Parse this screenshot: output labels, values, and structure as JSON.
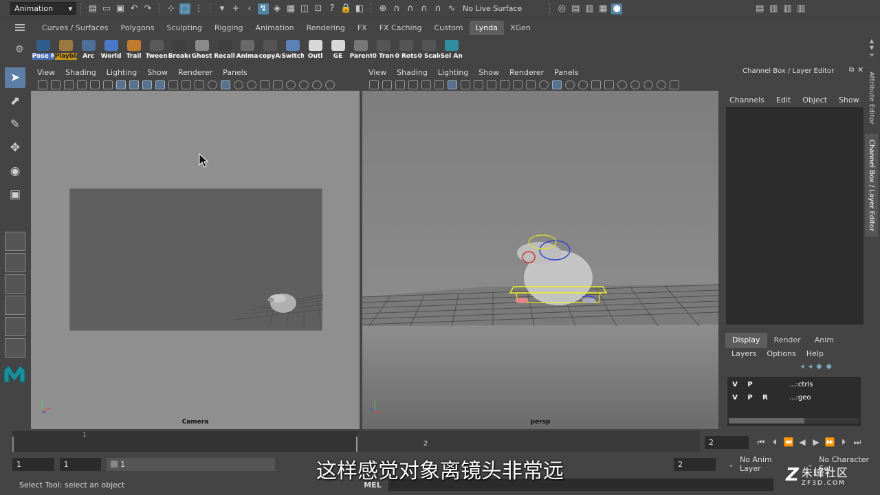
{
  "status_line": {
    "mode": "Animation",
    "live_surface": "No Live Surface"
  },
  "shelf_tabs": [
    "Curves / Surfaces",
    "Polygons",
    "Sculpting",
    "Rigging",
    "Animation",
    "Rendering",
    "FX",
    "FX Caching",
    "Custom",
    "Lynda",
    "XGen"
  ],
  "active_shelf_tab": "Lynda",
  "shelf_buttons": [
    {
      "label": "Pose M",
      "icon": "pose-icon",
      "color": "#2f5e8c"
    },
    {
      "label": "Playbla",
      "icon": "playblast-icon",
      "color": "#9a7a40"
    },
    {
      "label": "Arc",
      "icon": "arc-icon",
      "color": "#4e6f9a"
    },
    {
      "label": "World",
      "icon": "world-icon",
      "color": "#4b78c8"
    },
    {
      "label": "Trail",
      "icon": "trail-icon",
      "color": "#c07a30"
    },
    {
      "label": "Tween",
      "icon": "tween-icon",
      "color": "#5a5a5a"
    },
    {
      "label": "Breakd",
      "icon": "breakdown-icon",
      "color": "#404040"
    },
    {
      "label": "Ghost",
      "icon": "ghost-icon",
      "color": "#8a8a8a"
    },
    {
      "label": "Recall",
      "icon": "recall-icon",
      "color": "#3f3f3f"
    },
    {
      "label": "Animat",
      "icon": "animate-icon",
      "color": "#6a6a6a"
    },
    {
      "label": "copyAr",
      "icon": "copy-icon",
      "color": "#555555"
    },
    {
      "label": "Switch",
      "icon": "switch-icon",
      "color": "#5a82b8"
    },
    {
      "label": "Outl",
      "icon": "outliner-icon",
      "color": "#d8d8d8"
    },
    {
      "label": "GE",
      "icon": "graph-editor-icon",
      "color": "#d8d8d8"
    },
    {
      "label": "Parent",
      "icon": "parent-icon",
      "color": "#777777"
    },
    {
      "label": "0 Tran:",
      "icon": "zero-translate-icon",
      "color": "#555555"
    },
    {
      "label": "0 Rots",
      "icon": "zero-rotate-icon",
      "color": "#555555"
    },
    {
      "label": "0 Scale",
      "icon": "zero-scale-icon",
      "color": "#555555"
    },
    {
      "label": "Sel Ani",
      "icon": "select-anim-icon",
      "color": "#2f8fa0"
    }
  ],
  "viewport_menus": [
    "View",
    "Shading",
    "Lighting",
    "Show",
    "Renderer",
    "Panels"
  ],
  "left_viewport": {
    "label": "Camera"
  },
  "right_viewport": {
    "label": "persp"
  },
  "channel_box": {
    "title": "Channel Box / Layer Editor",
    "menus": [
      "Channels",
      "Edit",
      "Object",
      "Show"
    ]
  },
  "layer_editor": {
    "tabs": [
      "Display",
      "Render",
      "Anim"
    ],
    "active_tab": "Display",
    "menus": [
      "Layers",
      "Options",
      "Help"
    ],
    "layers": [
      {
        "v": "V",
        "p": "P",
        "r": "",
        "name": "...:ctrls"
      },
      {
        "v": "V",
        "p": "P",
        "r": "R",
        "name": "...:geo"
      }
    ]
  },
  "side_tabs": [
    "Attribute Editor",
    "Channel Box / Layer Editor"
  ],
  "time_slider": {
    "tick_1": "1",
    "tick_2": "2",
    "current_frame_marker": "2",
    "current_frame_field": "2"
  },
  "range_slider": {
    "start_field": "1",
    "playback_start": "1",
    "range_handle": "1",
    "end_field": "2",
    "anim_layer": "No Anim Layer",
    "character_set": "No Character Set"
  },
  "help_line": {
    "text": "Select Tool: select an object",
    "command_lang": "MEL"
  },
  "subtitle": "这样感觉对象离镜头非常远",
  "watermark": {
    "line1": "朱峰社区",
    "line2": "ZF3D.COM"
  }
}
